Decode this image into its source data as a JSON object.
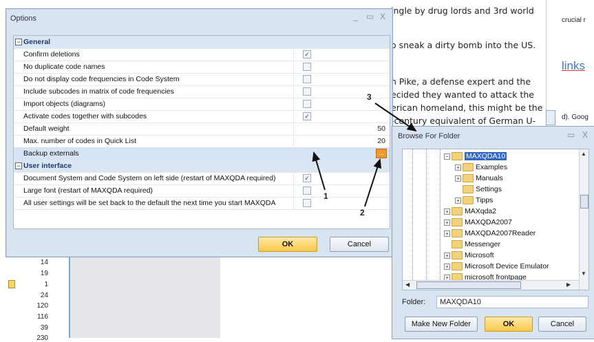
{
  "background_doc": {
    "lines": [
      "ingle by drug lords and 3rd world",
      "o sneak a dirty bomb into the US.",
      "n Pike, a defense expert and the",
      "ecided they wanted to attack the",
      "erican homeland, this might be the",
      "-century equivalent of German U-"
    ],
    "right_text_1": "crucial r",
    "right_link": "links",
    "right_text_2": "d). Goog"
  },
  "background_list": {
    "numbers": [
      "14",
      "19",
      "1",
      "24",
      "120",
      "116",
      "39",
      "230"
    ]
  },
  "options_dialog": {
    "title": "Options",
    "min_glyph": "_",
    "max_glyph": "▭",
    "close_glyph": "X",
    "general_header": "General",
    "general_toggle": "−",
    "general_rows": [
      {
        "label": "Confirm deletions",
        "checked": "✓"
      },
      {
        "label": "No duplicate code names",
        "checked": ""
      },
      {
        "label": "Do not display code frequencies in Code System",
        "checked": ""
      },
      {
        "label": "Include subcodes in matrix of code frequencies",
        "checked": ""
      },
      {
        "label": "Import objects (diagrams)",
        "checked": ""
      },
      {
        "label": "Activate codes together with subcodes",
        "checked": "✓"
      }
    ],
    "default_weight_label": "Default weight",
    "default_weight_value": "50",
    "max_codes_label": "Max. number of codes in Quick List",
    "max_codes_value": "20",
    "backup_label": "Backup externals",
    "backup_button": "...",
    "ui_header": "User interface",
    "ui_toggle": "−",
    "ui_rows": [
      {
        "label": "Document System and Code System on left side (restart of MAXQDA required)",
        "checked": "✓"
      },
      {
        "label": "Large font (restart of MAXQDA required)",
        "checked": ""
      },
      {
        "label": "All user settings will be set back to the default the next time you start MAXQDA",
        "checked": ""
      }
    ],
    "ok_label": "OK",
    "cancel_label": "Cancel"
  },
  "annotations": {
    "one": "1",
    "two": "2",
    "three": "3"
  },
  "browse_dialog": {
    "title": "Browse For Folder",
    "max_glyph": "▭",
    "close_glyph": "X",
    "tree": [
      {
        "label": "MAXQDA10",
        "indent": 0,
        "selected": true,
        "expander": "−"
      },
      {
        "label": "Examples",
        "indent": 1,
        "selected": false,
        "expander": "+"
      },
      {
        "label": "Manuals",
        "indent": 1,
        "selected": false,
        "expander": "+"
      },
      {
        "label": "Settings",
        "indent": 1,
        "selected": false,
        "expander": ""
      },
      {
        "label": "Tipps",
        "indent": 1,
        "selected": false,
        "expander": "+"
      },
      {
        "label": "MAXqda2",
        "indent": 0,
        "selected": false,
        "expander": "+"
      },
      {
        "label": "MAXQDA2007",
        "indent": 0,
        "selected": false,
        "expander": "+"
      },
      {
        "label": "MAXQDA2007Reader",
        "indent": 0,
        "selected": false,
        "expander": "+"
      },
      {
        "label": "Messenger",
        "indent": 0,
        "selected": false,
        "expander": ""
      },
      {
        "label": "Microsoft",
        "indent": 0,
        "selected": false,
        "expander": "+"
      },
      {
        "label": "Microsoft Device Emulator",
        "indent": 0,
        "selected": false,
        "expander": "+"
      },
      {
        "label": "microsoft frontpage",
        "indent": 0,
        "selected": false,
        "expander": "+"
      }
    ],
    "folder_label": "Folder:",
    "folder_value": "MAXQDA10",
    "make_new_folder": "Make New Folder",
    "ok_label": "OK",
    "cancel_label": "Cancel"
  },
  "colors": {
    "accent": "#f09a2b",
    "selection": "#3166c4",
    "dialog_bg": "#d9e4f1"
  }
}
